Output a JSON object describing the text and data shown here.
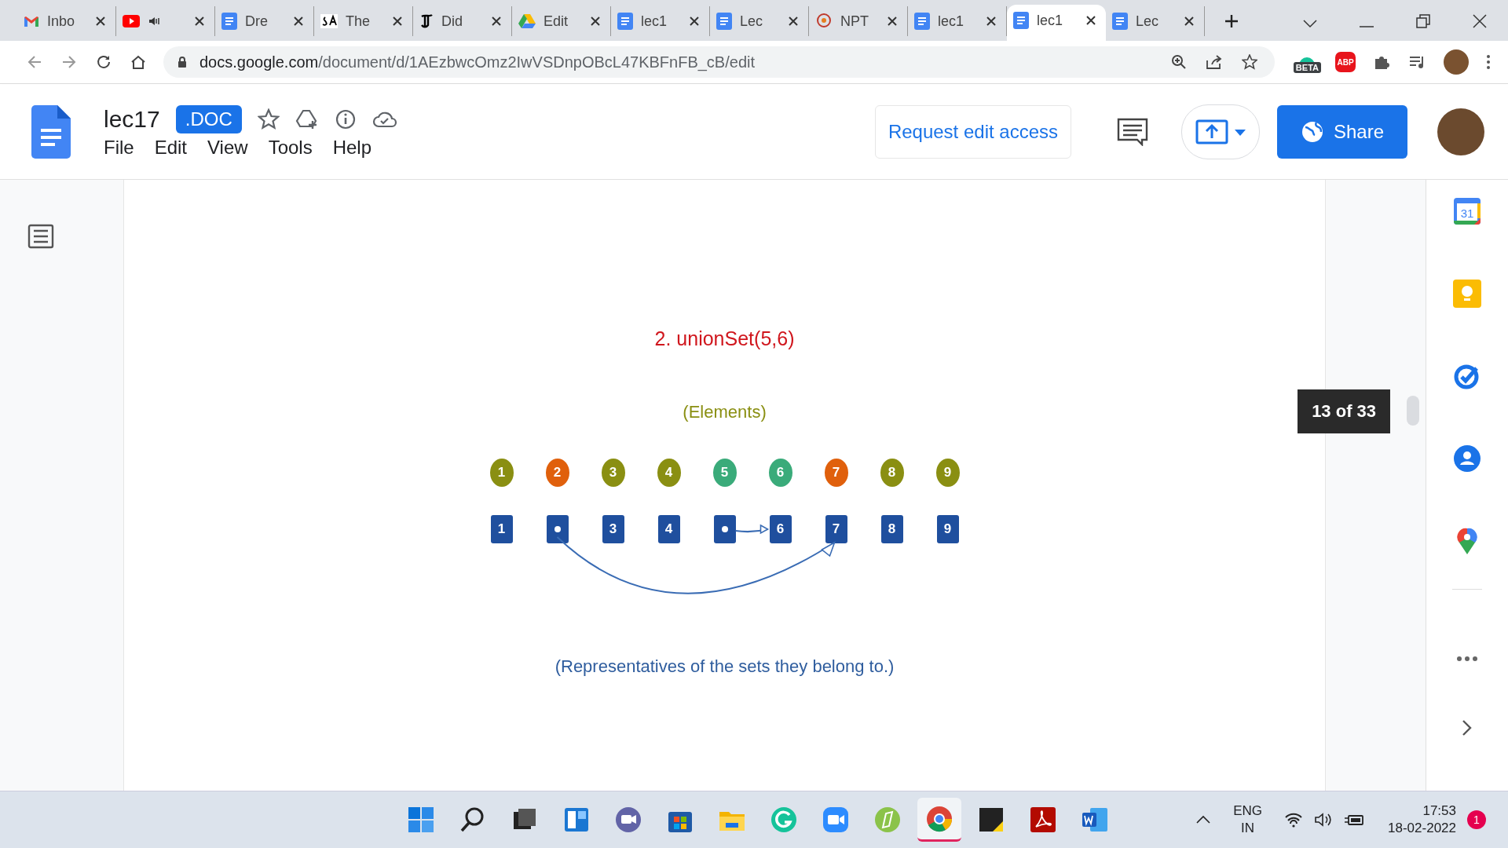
{
  "tabs": [
    {
      "kind": "gmail",
      "label": "Inbo",
      "selected": false
    },
    {
      "kind": "youtube",
      "muted": true,
      "selected": false
    },
    {
      "kind": "docs",
      "label": "Dre",
      "selected": false
    },
    {
      "kind": "sa",
      "label": "The",
      "selected": false
    },
    {
      "kind": "nyt",
      "label": "Did",
      "selected": false
    },
    {
      "kind": "drive",
      "label": "Edit",
      "selected": false
    },
    {
      "kind": "docs",
      "label": "lec1",
      "selected": false
    },
    {
      "kind": "docs",
      "label": "Lec",
      "selected": false
    },
    {
      "kind": "nptel",
      "label": "NPT",
      "selected": false
    },
    {
      "kind": "docs",
      "label": "lec1",
      "selected": false
    },
    {
      "kind": "docs",
      "label": "lec1",
      "selected": true
    },
    {
      "kind": "docs",
      "label": "Lec",
      "selected": false
    }
  ],
  "address": {
    "host": "docs.google.com",
    "path": "/document/d/1AEzbwcOmz2IwVSDnpOBcL47KBFnFB_cB/edit"
  },
  "extension_badge": "BETA",
  "adblock_label": "ABP",
  "doc": {
    "title": "lec17",
    "badge": ".DOC",
    "menus": [
      "File",
      "Edit",
      "View",
      "Tools",
      "Help"
    ],
    "request_button": "Request edit access",
    "share_button": "Share"
  },
  "slide": {
    "title": "2. unionSet(5,6)",
    "elements_caption": "(Elements)",
    "elements": [
      {
        "label": "1",
        "color": "#8a8f12"
      },
      {
        "label": "2",
        "color": "#e0600c"
      },
      {
        "label": "3",
        "color": "#8a8f12"
      },
      {
        "label": "4",
        "color": "#8a8f12"
      },
      {
        "label": "5",
        "color": "#3aab7a"
      },
      {
        "label": "6",
        "color": "#3aab7a"
      },
      {
        "label": "7",
        "color": "#e0600c"
      },
      {
        "label": "8",
        "color": "#8a8f12"
      },
      {
        "label": "9",
        "color": "#8a8f12"
      }
    ],
    "representatives": [
      {
        "kind": "number",
        "label": "1"
      },
      {
        "kind": "pointer_curve"
      },
      {
        "kind": "number",
        "label": "3"
      },
      {
        "kind": "number",
        "label": "4"
      },
      {
        "kind": "pointer_next"
      },
      {
        "kind": "number",
        "label": "6"
      },
      {
        "kind": "number",
        "label": "7"
      },
      {
        "kind": "number",
        "label": "8"
      },
      {
        "kind": "number",
        "label": "9"
      }
    ],
    "representatives_caption": "(Representatives of the sets they belong to.)"
  },
  "page_tooltip": "13 of 33",
  "calendar_day": "31",
  "tray": {
    "language": "ENG",
    "region": "IN",
    "time": "17:53",
    "date": "18-02-2022",
    "notifications": "1"
  }
}
